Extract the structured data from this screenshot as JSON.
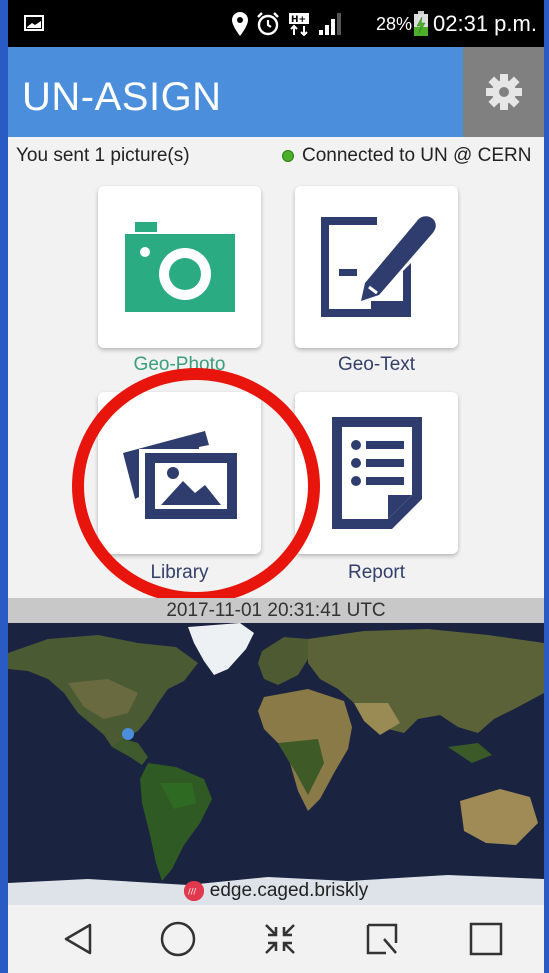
{
  "status_bar": {
    "battery": "28%",
    "time": "02:31 p.m."
  },
  "app_bar": {
    "title": "UN-ASIGN"
  },
  "info": {
    "sent_text": "You sent 1 picture(s)",
    "connection_text": "Connected to UN @ CERN"
  },
  "tiles": [
    {
      "label": "Geo-Photo",
      "icon": "camera-icon",
      "color": "#2bab82"
    },
    {
      "label": "Geo-Text",
      "icon": "pen-note-icon",
      "color": "#2e3d6e"
    },
    {
      "label": "Library",
      "icon": "gallery-icon",
      "color": "#2e3d6e"
    },
    {
      "label": "Report",
      "icon": "report-list-icon",
      "color": "#2e3d6e"
    }
  ],
  "timestamp": "2017-11-01 20:31:41 UTC",
  "location": {
    "label": "edge.caged.briskly"
  },
  "nav": [
    "back-icon",
    "home-icon",
    "collapse-icon",
    "recent-icon",
    "square-icon"
  ]
}
